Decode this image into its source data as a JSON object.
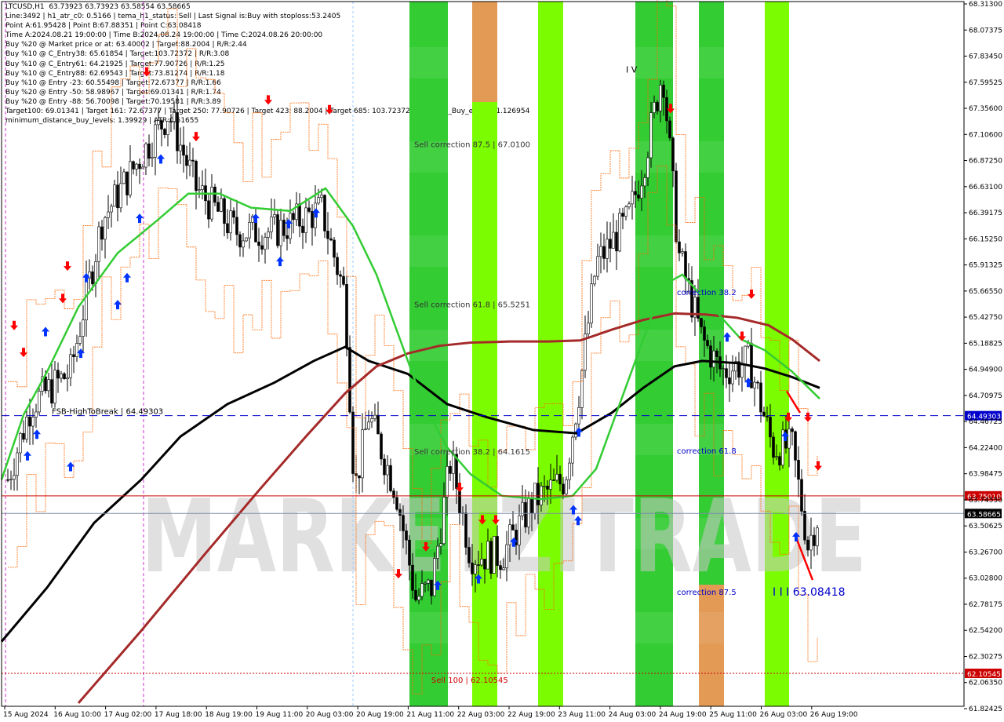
{
  "colors": {
    "background": "#ffffff",
    "axis": "#000000",
    "green_zone": "#33cc33",
    "lime_zone": "#7cfc00",
    "orange_zone": "#e39a55",
    "candle": "#000000",
    "ma_fast": "#33cc33",
    "ma_mid": "#a52a2a",
    "ma_slow": "#000000",
    "level_blue": "#0000cc",
    "level_red": "#cc0000",
    "level_price": "#7a8aa8",
    "arrow_buy": "#0033ff",
    "arrow_sell": "#ff0000",
    "orange_envelope": "#ff6600",
    "watermark": "#c8c8c8"
  },
  "info_lines": [
    "LTCUSD,H1  63.73923 63.73923 63.58554 63.58665",
    "Line:3492 | h1_atr_c0: 0.5166 | tema_h1_status: Sell | Last Signal is:Buy with stoploss:53.2405",
    "Point A:61.95428 | Point B:67.88351 | Point C:63.08418",
    "Time A:2024.08.21 19:00:00 | Time B:2024.08.24 19:00:00 | Time C:2024.08.26 20:00:00",
    "Buy %20 @ Market price or at: 63.40002 | Target:88.2004 | R/R:2.44",
    "Buy %10 @ C_Entry38: 65.61854 | Target:103.72372 | R/R:3.08",
    "Buy %10 @ C_Entry61: 64.21925 | Target:77.90726 | R/R:1.25",
    "Buy %10 @ C_Entry88: 62.69543 | Target:73.81274 | R/R:1.18",
    "Buy %10 @ Entry -23: 60.55498 | Target:72.67377 | R/R:1.66",
    "Buy %20 @ Entry -50: 58.98967 | Target:69.01341 | R/R:1.74",
    "Buy %20 @ Entry -88: 56.70098 | Target:70.19581 | R/R:3.89",
    "Target100: 69.01341 | Target 161: 72.67377 | Target 250: 77.90726 | Target 423: 88.2004 | Target 685: 103.72372 || average_Buy_entry: 61.126954",
    "minimum_distance_buy_levels: 1.39929 | ATR:0.51655"
  ],
  "chart_data": {
    "type": "candlestick",
    "symbol": "LTCUSD",
    "timeframe": "H1",
    "ylim": [
      61.8,
      68.33
    ],
    "y_ticks": [
      "68.31300",
      "68.07375",
      "67.83450",
      "67.59525",
      "67.35600",
      "67.10600",
      "66.87250",
      "66.63100",
      "66.39175",
      "66.15250",
      "65.91325",
      "65.66550",
      "65.42750",
      "65.18825",
      "64.94900",
      "64.70975",
      "64.46725",
      "64.22400",
      "63.98475",
      "63.74550",
      "63.50625",
      "63.26700",
      "63.02800",
      "62.78175",
      "62.54200",
      "62.30275",
      "62.06350",
      "61.82425"
    ],
    "x_labels": [
      "15 Aug 2024",
      "16 Aug 10:00",
      "17 Aug 02:00",
      "17 Aug 18:00",
      "18 Aug 19:00",
      "19 Aug 11:00",
      "20 Aug 03:00",
      "20 Aug 19:00",
      "21 Aug 11:00",
      "22 Aug 03:00",
      "22 Aug 19:00",
      "23 Aug 11:00",
      "24 Aug 03:00",
      "24 Aug 19:00",
      "25 Aug 11:00",
      "26 Aug 03:00",
      "26 Aug 19:00"
    ],
    "price_levels": [
      {
        "label": "FSB-HighToBreak | 64.49303",
        "value": 64.49303,
        "badge": "64.49303",
        "style": "dashed-blue"
      },
      {
        "label": "",
        "value": 63.7501,
        "badge": "63.75010",
        "style": "solid-red"
      },
      {
        "label": "",
        "value": 63.58665,
        "badge": "63.58665",
        "style": "solid-gray"
      },
      {
        "label": "Sell 100 | 62.10545",
        "value": 62.10545,
        "badge": "62.10545",
        "style": "dotted-red"
      }
    ],
    "zone_labels": [
      {
        "text": "Sell correction 87.5 | 67.0100",
        "value": 67.01
      },
      {
        "text": "Sell correction 61.8 | 65.5251",
        "value": 65.5251
      },
      {
        "text": "Sell correction 38.2 | 64.1615",
        "value": 64.1615
      },
      {
        "text": "correction 38.2",
        "value": 65.64
      },
      {
        "text": "correction 61.8",
        "value": 64.17
      },
      {
        "text": "correction 87.5",
        "value": 62.86
      }
    ],
    "wave_labels": [
      {
        "text": "I V",
        "value": 67.7
      },
      {
        "text": "I I I 63.08418",
        "value": 62.86
      }
    ],
    "watermark": "MARKETZITRADE"
  }
}
